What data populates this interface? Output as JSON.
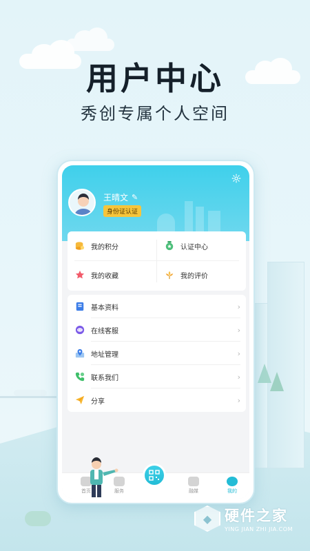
{
  "hero": {
    "title": "用户中心",
    "subtitle": "秀创专属个人空间"
  },
  "profile": {
    "name": "王晴文",
    "badge": "身份证认证",
    "colors": {
      "header": "#3fd0eb",
      "badge": "#f6c53b"
    }
  },
  "grid": [
    {
      "label": "我的积分",
      "icon": "coins-icon"
    },
    {
      "label": "认证中心",
      "icon": "medal-icon"
    },
    {
      "label": "我的收藏",
      "icon": "star-icon"
    },
    {
      "label": "我的评价",
      "icon": "flower-icon"
    }
  ],
  "menu": [
    {
      "label": "基本资料",
      "icon": "profile-card-icon"
    },
    {
      "label": "在线客服",
      "icon": "chat-bubble-icon"
    },
    {
      "label": "地址管理",
      "icon": "location-pin-icon"
    },
    {
      "label": "联系我们",
      "icon": "phone-icon"
    },
    {
      "label": "分享",
      "icon": "paper-plane-icon"
    }
  ],
  "tabbar": {
    "home": "首页",
    "service": "服务",
    "media": "融媒",
    "mine": "我的",
    "accent": "#23bcd6"
  },
  "brand": {
    "name": "硬件之家",
    "pinyin": "YING JIAN ZHI JIA.COM"
  }
}
